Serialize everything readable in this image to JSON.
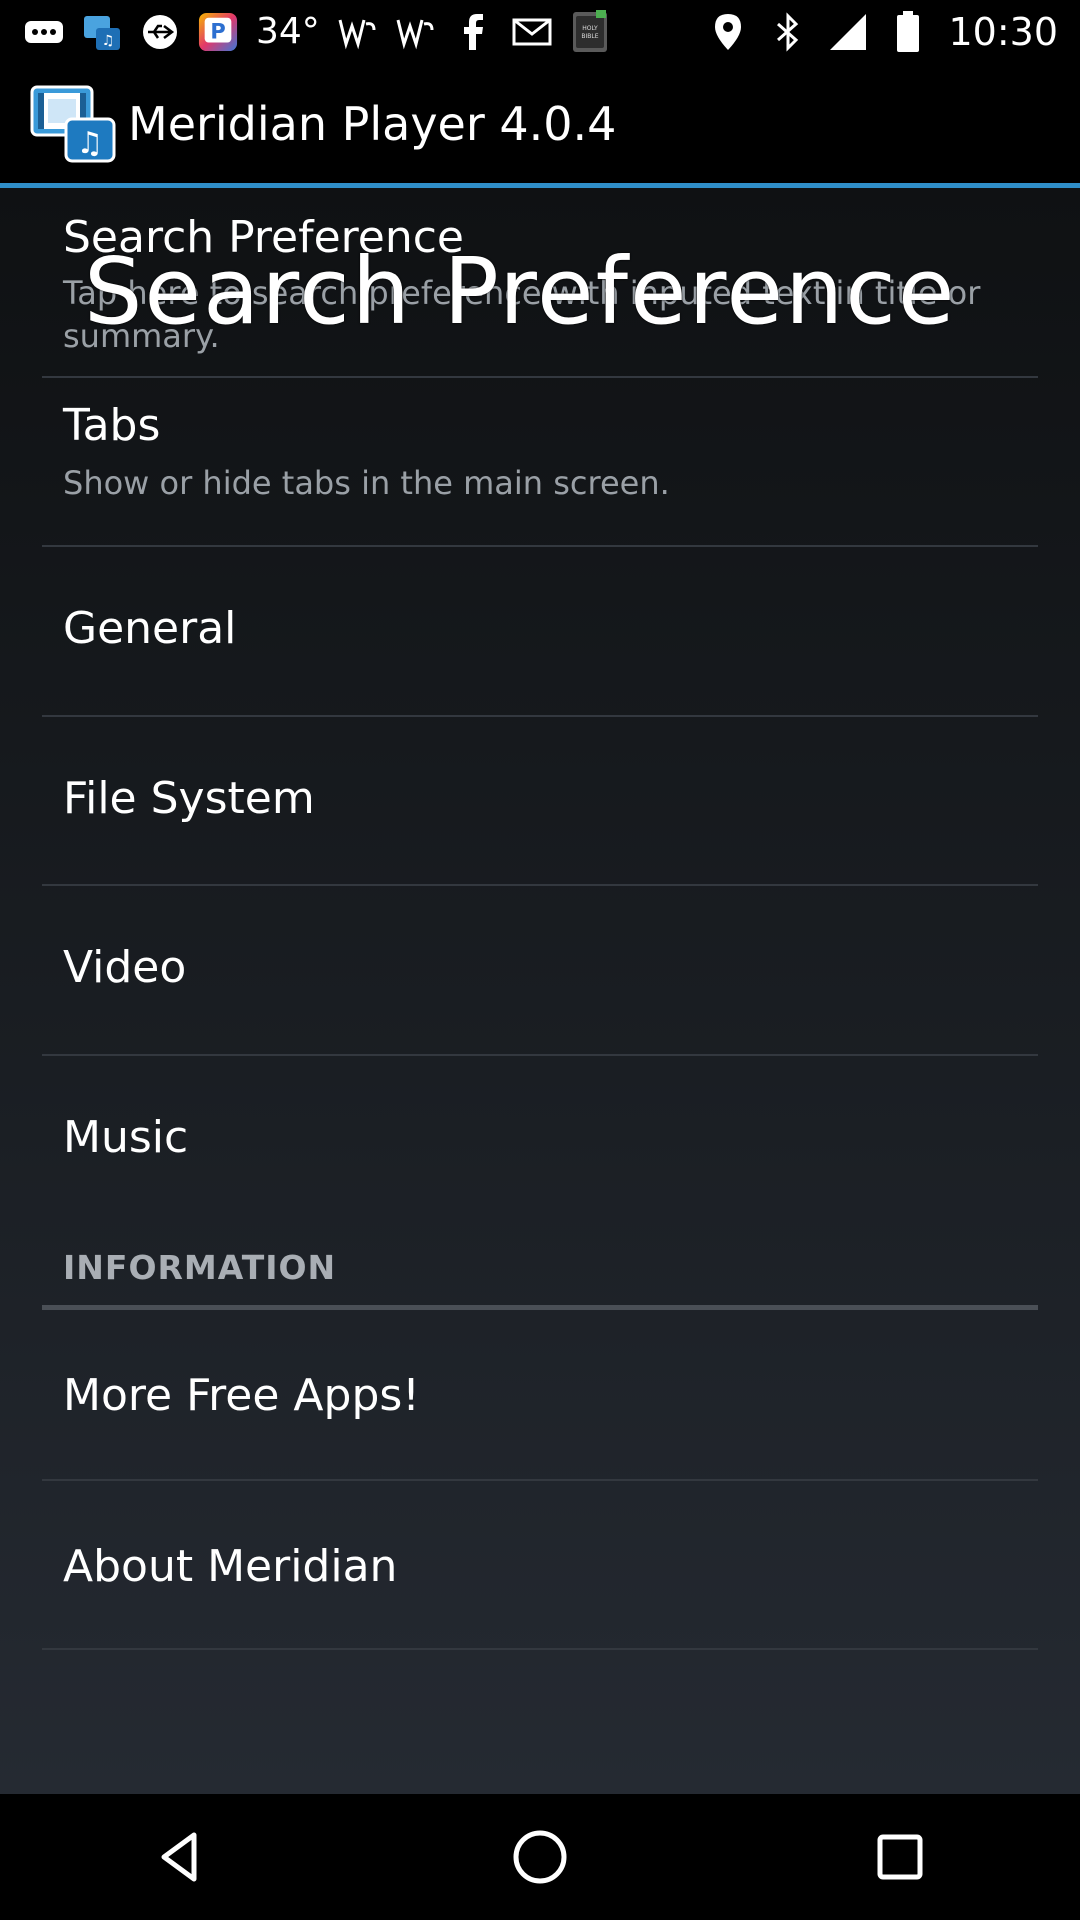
{
  "status_bar": {
    "temperature": "34°",
    "time": "10:30",
    "icons": [
      "more-icon",
      "app-notification-icon",
      "usb-icon",
      "pandora-icon",
      "weather-icon",
      "wind-icon",
      "wind-icon",
      "facebook-icon",
      "gmail-icon",
      "bible-app-icon",
      "location-icon",
      "bluetooth-icon",
      "signal-icon",
      "battery-icon"
    ]
  },
  "app_bar": {
    "title": "Meridian Player 4.0.4",
    "accent": "#2f8ec8"
  },
  "preferences": [
    {
      "title": "Search Preference",
      "summary": "Tap here to search preference with inputed text in title or summary."
    },
    {
      "title": "Tabs",
      "summary": "Show or hide tabs in the main screen."
    },
    {
      "title": "General"
    },
    {
      "title": "File System"
    },
    {
      "title": "Video"
    },
    {
      "title": "Music"
    }
  ],
  "section_information": "INFORMATION",
  "information_items": [
    {
      "title": "More Free Apps!"
    },
    {
      "title": "About Meridian"
    }
  ],
  "overlay": {
    "text": "Search Preference"
  },
  "nav_bar": {
    "buttons": [
      "back-icon",
      "home-icon",
      "recents-icon"
    ]
  }
}
